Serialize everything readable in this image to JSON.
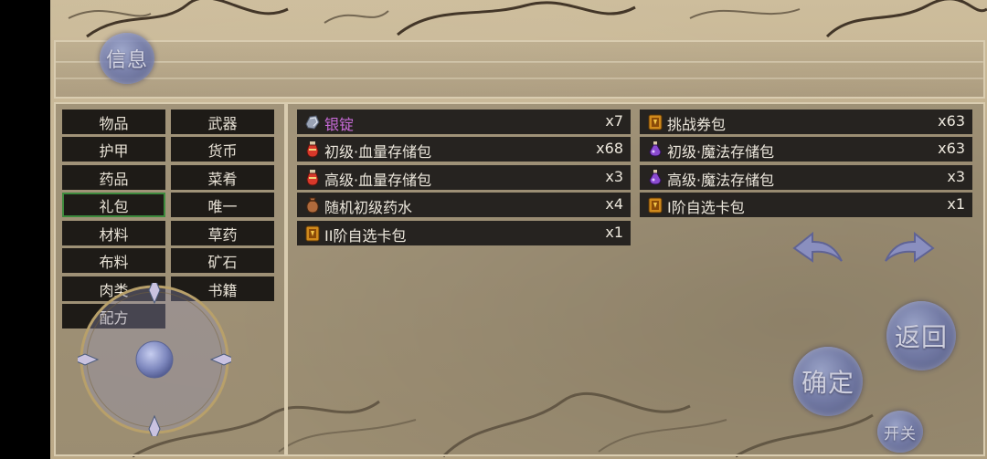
{
  "info_button": "信息",
  "categories": {
    "left": [
      "物品",
      "护甲",
      "药品",
      "礼包",
      "材料",
      "布料",
      "肉类",
      "配方"
    ],
    "right": [
      "武器",
      "货币",
      "菜肴",
      "唯一",
      "草药",
      "矿石",
      "书籍"
    ],
    "selected": "礼包"
  },
  "items_left": [
    {
      "name": "银锭",
      "qty": "x7",
      "icon": "silver-ingot-icon"
    },
    {
      "name": "初级·血量存储包",
      "qty": "x68",
      "icon": "red-potion-icon"
    },
    {
      "name": "高级·血量存储包",
      "qty": "x3",
      "icon": "red-potion-icon"
    },
    {
      "name": "随机初级药水",
      "qty": "x4",
      "icon": "pouch-icon"
    },
    {
      "name": "II阶自选卡包",
      "qty": "x1",
      "icon": "card-pack-icon"
    }
  ],
  "items_right": [
    {
      "name": "挑战券包",
      "qty": "x63",
      "icon": "card-pack-icon"
    },
    {
      "name": "初级·魔法存储包",
      "qty": "x63",
      "icon": "purple-potion-icon"
    },
    {
      "name": "高级·魔法存储包",
      "qty": "x3",
      "icon": "purple-potion-icon"
    },
    {
      "name": "I阶自选卡包",
      "qty": "x1",
      "icon": "card-pack-icon"
    }
  ],
  "buttons": {
    "back": "返回",
    "confirm": "确定",
    "toggle": "开关"
  },
  "colors": {
    "parchment": "#c2b08e",
    "slot_bg": "#262320",
    "rare_text": "#c86bd8",
    "selected_border": "#3d8a3d",
    "orb": "#6f7ab0"
  }
}
